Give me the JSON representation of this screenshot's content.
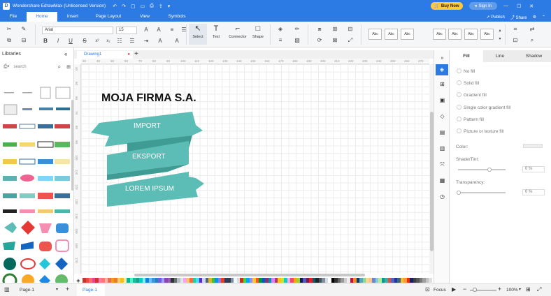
{
  "app": {
    "title": "Wondershare EdrawMax (Unlicensed Version)",
    "buy_now": "Buy Now",
    "sign_in": "Sign In",
    "publish": "Publish",
    "share": "Share",
    "brand_color": "#2c7be5"
  },
  "menu": {
    "tabs": [
      "File",
      "Home",
      "Insert",
      "Page Layout",
      "View",
      "Symbols"
    ],
    "active": "Home"
  },
  "ribbon": {
    "font_family": "Arial",
    "font_size": "15",
    "tools": {
      "select": "Select",
      "text": "Text",
      "connector": "Connector",
      "shape": "Shape"
    },
    "style_presets": [
      "Abc",
      "Abc",
      "Abc",
      "Abc",
      "Abc",
      "Abc",
      "Abc"
    ]
  },
  "libraries": {
    "title": "Libraries",
    "search_placeholder": "search"
  },
  "document": {
    "tab": "Drawing1",
    "ruler_h": [
      "30",
      "40",
      "50",
      "60",
      "70",
      "80",
      "90",
      "100",
      "110",
      "120",
      "130",
      "140",
      "150",
      "160",
      "170",
      "180",
      "190",
      "200",
      "210",
      "220",
      "230",
      "240",
      "250",
      "260",
      "270"
    ],
    "ruler_v": [
      "40",
      "50",
      "60",
      "70",
      "80",
      "90",
      "100",
      "110",
      "120",
      "130",
      "140",
      "150",
      "160",
      "170"
    ]
  },
  "canvas": {
    "title": "MOJA FIRMA S.A.",
    "banners": [
      "IMPORT",
      "EKSPORT",
      "LOREM IPSUM"
    ],
    "banner_color": "#5bbdb5",
    "banner_fold_color": "#3e9c94"
  },
  "properties": {
    "tabs": [
      "Fill",
      "Line",
      "Shadow"
    ],
    "active_tab": "Fill",
    "fill_options": [
      "No fill",
      "Solid fill",
      "Gradient fill",
      "Single color gradient fill",
      "Pattern fill",
      "Picture or texture fill"
    ],
    "color_label": "Color:",
    "shade_label": "Shade/Tint:",
    "shade_value": "0 %",
    "transparency_label": "Transparency:",
    "transparency_value": "0 %"
  },
  "status": {
    "page_selector": "Page-1",
    "page_tab": "Page-1",
    "focus": "Focus",
    "zoom": "100%"
  },
  "palette": [
    "#c0392b",
    "#e74c3c",
    "#ff6b6b",
    "#e84393",
    "#d63031",
    "#fd79a8",
    "#ff7675",
    "#fab1a0",
    "#e17055",
    "#f39c12",
    "#e67e22",
    "#fdcb6e",
    "#f1c40f",
    "#ffeaa7",
    "#00b894",
    "#55efc4",
    "#1abc9c",
    "#16a085",
    "#00cec9",
    "#81ecec",
    "#0984e3",
    "#74b9ff",
    "#3498db",
    "#2980b9",
    "#6c5ce7",
    "#a29bfe",
    "#8e44ad",
    "#9b59b6",
    "#2d3436",
    "#636e72",
    "#b2bec3",
    "#dfe6e9",
    "#ff9ff3",
    "#feca57",
    "#ff6348",
    "#1dd1a1",
    "#48dbfb",
    "#5f27cd",
    "#c8d6e5",
    "#576574",
    "#e1b12c",
    "#44bd32",
    "#0097e6",
    "#8c7ae6",
    "#e84118",
    "#273c75",
    "#353b48",
    "#7f8fa6",
    "#f5f6fa",
    "#dcdde1",
    "#c23616",
    "#4cd137",
    "#00a8ff",
    "#9c88ff",
    "#fbc531",
    "#ee5a24",
    "#009432",
    "#0652dd",
    "#833471",
    "#1289a7",
    "#d980fa",
    "#b53471",
    "#ffc312",
    "#c4e538",
    "#12cbc4",
    "#fda7df",
    "#ed4c67",
    "#f79f1f",
    "#a3cb38",
    "#1b1464",
    "#5758bb",
    "#6f1e51",
    "#ea2027",
    "#006266",
    "#1e272e",
    "#485460",
    "#808e9b",
    "#d2dae2",
    "#ffffff",
    "#000000",
    "#333333",
    "#666666",
    "#999999",
    "#cccccc",
    "#eeeeee",
    "#b71540",
    "#e58e26",
    "#0a3d62",
    "#60a3bc",
    "#78e08f",
    "#fad390",
    "#f8c291",
    "#6a89cc",
    "#82ccdd",
    "#b8e994",
    "#079992",
    "#38ada9",
    "#e55039",
    "#4a69bd",
    "#1e3799",
    "#3c6382",
    "#f6b93b",
    "#fa983a",
    "#eb2f06",
    "#0c2461",
    "#3d3d3d",
    "#575757",
    "#7a7a7a",
    "#a0a0a0",
    "#c2c2c2",
    "#dedede"
  ]
}
